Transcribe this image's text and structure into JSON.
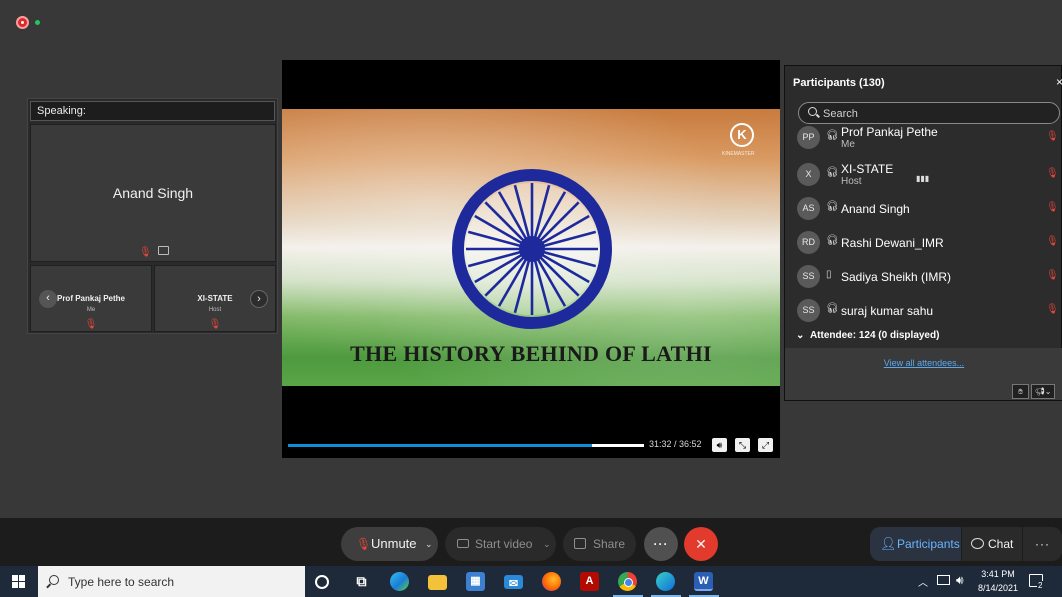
{
  "speaking_panel": {
    "header": "Speaking:",
    "main_speaker": "Anand Singh",
    "thumbnails": [
      {
        "name": "Prof Pankaj Pethe",
        "role": "Me"
      },
      {
        "name": "XI-STATE",
        "role": "Host"
      }
    ]
  },
  "video": {
    "title": "THE HISTORY BEHIND OF LATHI",
    "logo_letter": "K",
    "logo_caption": "KINEMASTER",
    "time": "31:32 / 36:52",
    "progress": 0.855
  },
  "participants": {
    "title": "Participants (130)",
    "search_placeholder": "Search",
    "list": [
      {
        "initials": "PP",
        "name": "Prof Pankaj Pethe",
        "role": "Me"
      },
      {
        "initials": "X",
        "name": "XI-STATE",
        "role": "Host"
      },
      {
        "initials": "AS",
        "name": "Anand Singh",
        "role": ""
      },
      {
        "initials": "RD",
        "name": "Rashi Dewani_IMR",
        "role": ""
      },
      {
        "initials": "SS",
        "name": "Sadiya Sheikh (IMR)",
        "role": ""
      },
      {
        "initials": "SS",
        "name": "suraj kumar sahu",
        "role": ""
      }
    ],
    "attendee_summary": "Attendee: 124 (0 displayed)",
    "view_all": "View all attendees..."
  },
  "controls": {
    "unmute": "Unmute",
    "start_video": "Start video",
    "share": "Share",
    "participants": "Participants",
    "chat": "Chat"
  },
  "taskbar": {
    "search_placeholder": "Type here to search",
    "time": "3:41 PM",
    "date": "8/14/2021",
    "notifications": "2"
  },
  "colors": {
    "accent": "#6ab4ff",
    "leave": "#e23a2c",
    "muted_mic": "#e8453c",
    "progress": "#0b8fd6"
  }
}
